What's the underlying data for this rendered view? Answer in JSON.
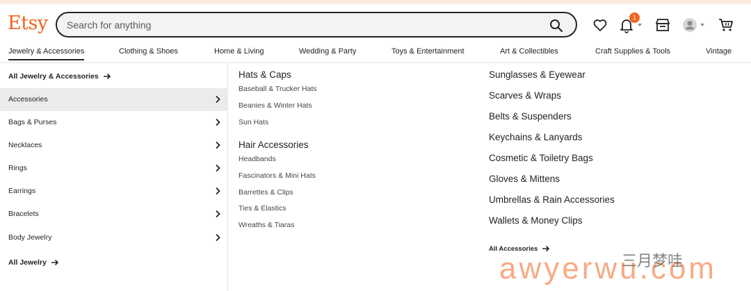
{
  "header": {
    "logo": "Etsy",
    "search_placeholder": "Search for anything",
    "notification_count": "1"
  },
  "categories": [
    "Jewelry & Accessories",
    "Clothing & Shoes",
    "Home & Living",
    "Wedding & Party",
    "Toys & Entertainment",
    "Art & Collectibles",
    "Craft Supplies & Tools",
    "Vintage"
  ],
  "left": {
    "all_top": "All Jewelry & Accessories",
    "items": [
      "Accessories",
      "Bags & Purses",
      "Necklaces",
      "Rings",
      "Earrings",
      "Bracelets",
      "Body Jewelry"
    ],
    "all_bottom": "All Jewelry"
  },
  "middle": {
    "groups": [
      {
        "title": "Hats & Caps",
        "items": [
          "Baseball & Trucker Hats",
          "Beanies & Winter Hats",
          "Sun Hats"
        ]
      },
      {
        "title": "Hair Accessories",
        "items": [
          "Headbands",
          "Fascinators & Mini Hats",
          "Barrettes & Clips",
          "Ties & Elastics",
          "Wreaths & Tiaras"
        ]
      }
    ]
  },
  "right": {
    "items": [
      "Sunglasses & Eyewear",
      "Scarves & Wraps",
      "Belts & Suspenders",
      "Keychains & Lanyards",
      "Cosmetic & Toiletry Bags",
      "Gloves & Mittens",
      "Umbrellas & Rain Accessories",
      "Wallets & Money Clips"
    ],
    "all": "All Accessories"
  },
  "watermark": {
    "text": "awyerwu.com",
    "cn": "三月梦哇"
  },
  "colors": {
    "brand": "#f1641e",
    "selected_row": "#ebebeb"
  },
  "icons": [
    "search-icon",
    "heart-icon",
    "bell-icon",
    "shop-icon",
    "avatar-icon",
    "cart-icon",
    "chevron-right-icon",
    "arrow-right-icon"
  ]
}
